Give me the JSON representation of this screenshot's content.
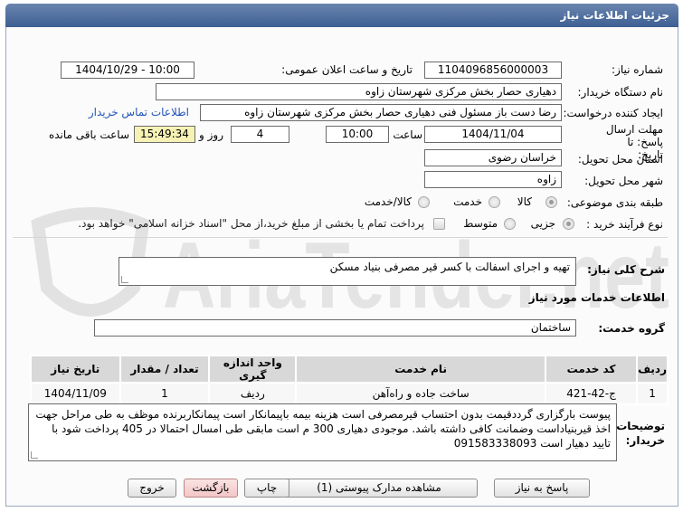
{
  "header": {
    "title": "جزئیات اطلاعات نیاز"
  },
  "fields": {
    "need_number_label": "شماره نیاز:",
    "need_number": "1104096856000003",
    "announce_label": "تاریخ و ساعت اعلان عمومی:",
    "announce_value": "1404/10/29 - 10:00",
    "buyer_org_label": "نام دستگاه خریدار:",
    "buyer_org": "دهیاری حصار بخش مرکزی شهرستان زاوه",
    "creator_label": "ایجاد کننده درخواست:",
    "creator": "رضا دست باز مسئول فنی دهیاری حصار بخش مرکزی شهرستان زاوه",
    "contact_link": "اطلاعات تماس خریدار",
    "deadline_label": "مهلت ارسال پاسخ: تا تاریخ:",
    "deadline_date": "1404/11/04",
    "time_label": "ساعت",
    "deadline_time": "10:00",
    "days": "4",
    "days_label": "روز و",
    "remaining": "15:49:34",
    "remaining_label": "ساعت باقی مانده",
    "province_label": "استان محل تحویل:",
    "province": "خراسان رضوی",
    "city_label": "شهر محل تحویل:",
    "city": "زاوه",
    "category_label": "طبقه بندی موضوعی:",
    "category_options": [
      "کالا",
      "خدمت",
      "کالا/خدمت"
    ],
    "process_label": "نوع فرآیند خرید :",
    "process_options": [
      "جزیی",
      "متوسط"
    ],
    "payment_note": "پرداخت تمام یا بخشی از مبلغ خرید،از محل \"اسناد خزانه اسلامی\" خواهد بود."
  },
  "summary": {
    "label": "شرح کلی نیاز:",
    "value": "تهیه و اجرای اسفالت با کسر قیر مصرفی بنیاد مسکن"
  },
  "services": {
    "section_title": "اطلاعات خدمات مورد نیاز",
    "group_label": "گروه خدمت:",
    "group_value": "ساختمان",
    "columns": [
      "ردیف",
      "کد خدمت",
      "نام خدمت",
      "واحد اندازه گیری",
      "تعداد / مقدار",
      "تاریخ نیاز"
    ],
    "rows": [
      [
        "1",
        "ج-42-421",
        "ساخت جاده و راه‌آهن",
        "ردیف",
        "1",
        "1404/11/09"
      ]
    ]
  },
  "buyer_notes": {
    "label": "توضیحات خریدار:",
    "value": "پیوست بارگزاری گرددقیمت بدون احتساب قیرمصرفی است هزینه بیمه باپیمانکار است پیمانکاربرنده موظف به طی مراحل جهت اخذ قیربنیاداست وضمانت کافی داشته باشد. موجودی دهیاری 300 م است مابقی طی امسال احتمالا در 405 پرداخت شود با تایید دهیار است 091583338093"
  },
  "buttons": {
    "reply": "پاسخ به نیاز",
    "attachments": "مشاهده مدارک پیوستی (1)",
    "print": "چاپ",
    "back": "بازگشت",
    "exit": "خروج"
  },
  "watermark": {
    "text": "AriaTender.net"
  },
  "colors": {
    "title_bar": "#3d5f92",
    "highlight": "#f6f2b5",
    "link": "#2255bb",
    "watermark": "#d9d9d9"
  }
}
